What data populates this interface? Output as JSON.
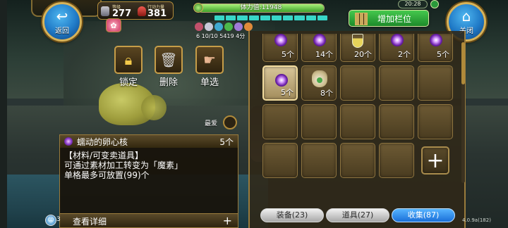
{
  "hud": {
    "back_label": "返回",
    "close_label": "关闭",
    "level_caption": "等级",
    "level_value": "277",
    "ap_caption": "行动力量",
    "ap_value": "381",
    "hp_text": "体力值:11948",
    "hp_fraction": 1.0,
    "status_text": "6  10/10  5419 4分",
    "time_text": "20:28",
    "add_slot_label": "增加栏位"
  },
  "actions": {
    "lock_label": "锁定",
    "delete_label": "删除",
    "select_label": "单选",
    "favorite_label": "最爱"
  },
  "detail": {
    "name": "蠕动的卵心核",
    "count": "5个",
    "lines": [
      "【材料/可变卖道具】",
      "可通过素材加工转变为「魔素」",
      "单格最多可放置(99)个"
    ],
    "more_label": "查看详细",
    "chat_count": "3"
  },
  "inventory": {
    "row1": [
      "5个",
      "14个",
      "20个",
      "2个",
      "5个"
    ],
    "row2": [
      "5个",
      "8个"
    ]
  },
  "tabs": {
    "equipment": "装备(23)",
    "items": "道具(27)",
    "collection": "收集(87)"
  },
  "version": "4.0.9a(182)",
  "colors": {
    "accent_blue": "#1a6fd8",
    "gold_border": "#c69d48",
    "green_button": "#45c84e"
  }
}
